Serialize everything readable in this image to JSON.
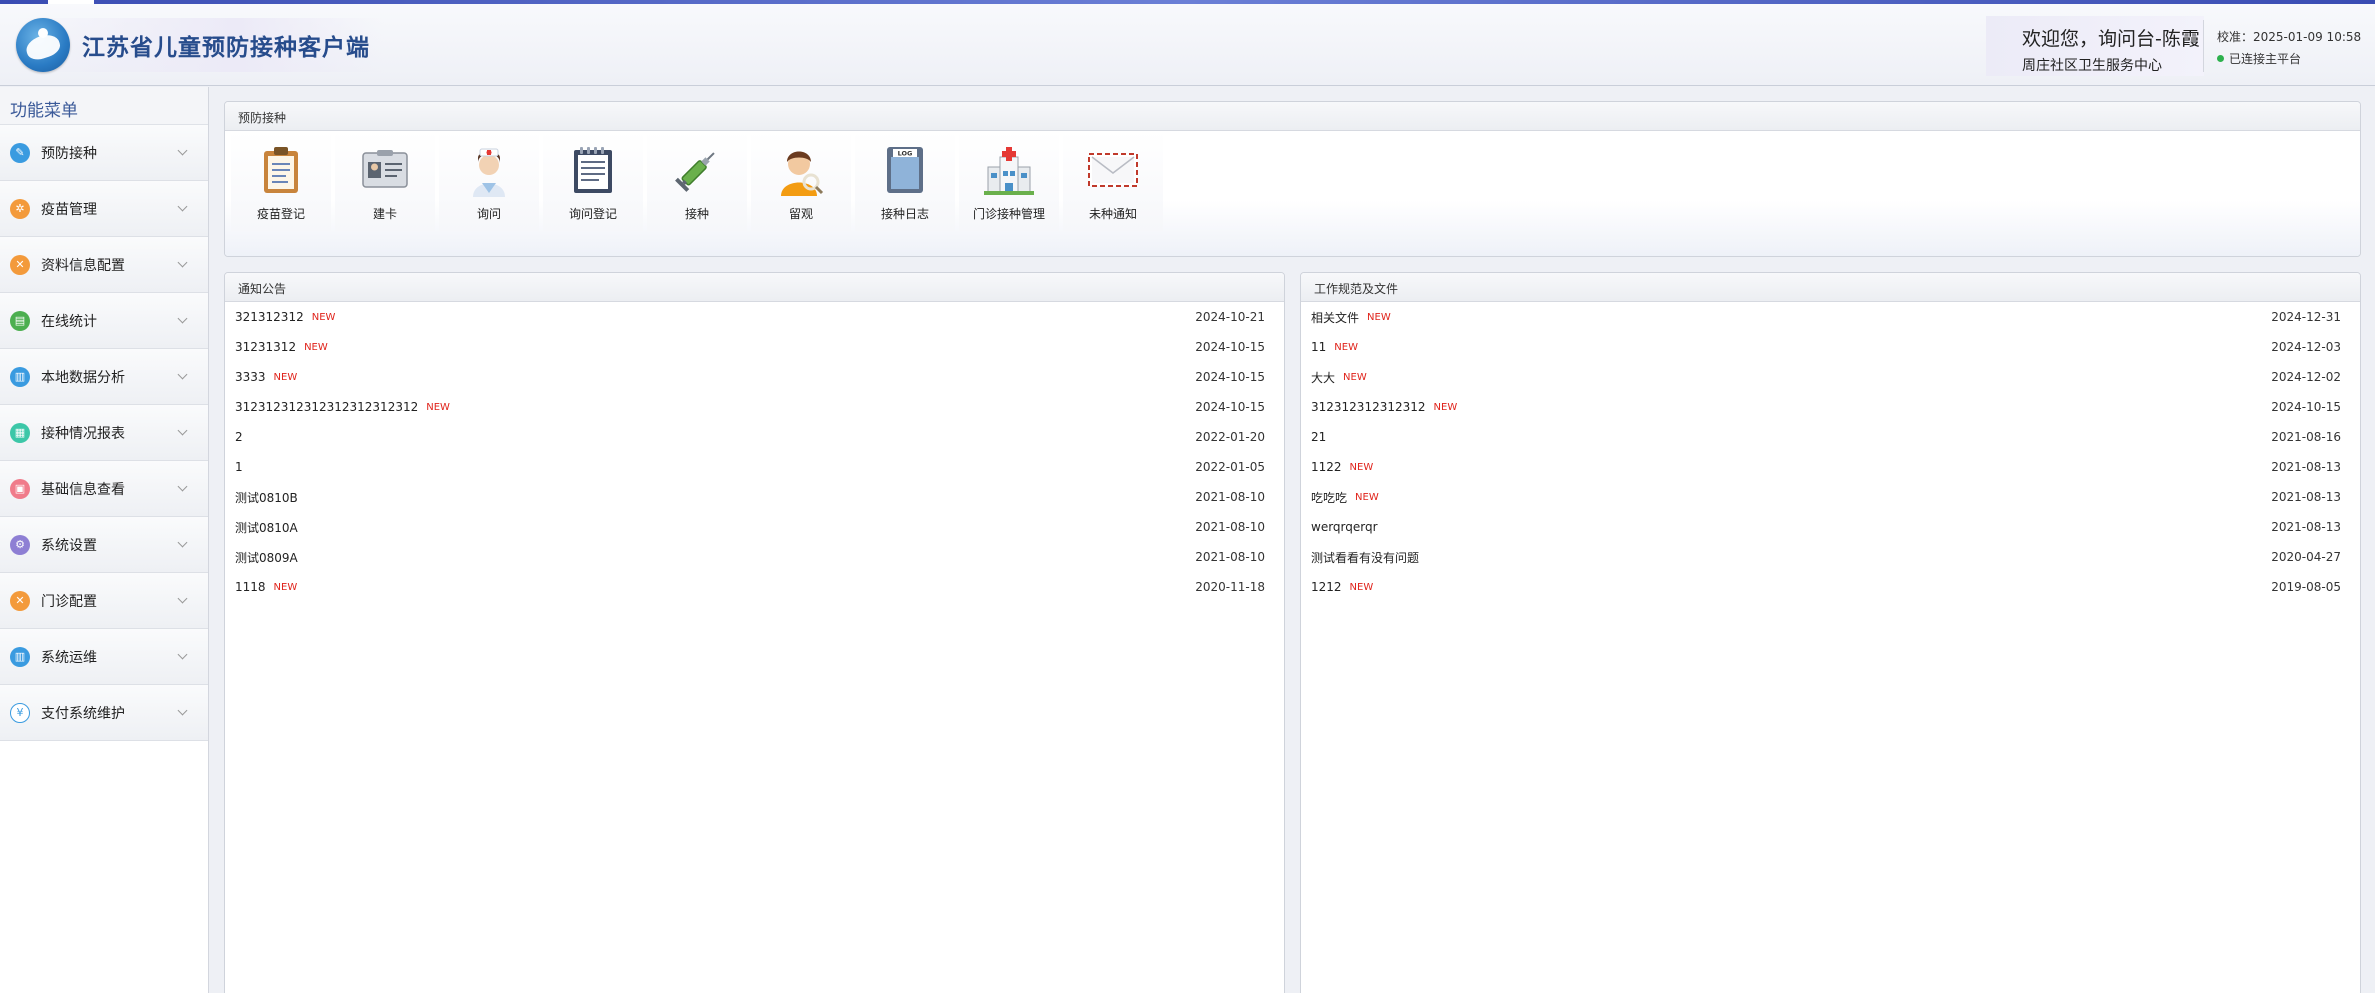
{
  "app": {
    "title": "江苏省儿童预防接种客户端",
    "welcome": "欢迎您，询问台-陈霞",
    "org": "周庄社区卫生服务中心",
    "sync_time": "校准：2025-01-09 10:58",
    "connection_status": "已连接主平台"
  },
  "sidebar": {
    "title": "功能菜单",
    "items": [
      {
        "label": "预防接种",
        "icon": "syringe-icon",
        "color": "#3a9be0",
        "glyph": "✎"
      },
      {
        "label": "疫苗管理",
        "icon": "vaccine-icon",
        "color": "#f39a3b",
        "glyph": "✲"
      },
      {
        "label": "资料信息配置",
        "icon": "config-icon",
        "color": "#f39a3b",
        "glyph": "✕"
      },
      {
        "label": "在线统计",
        "icon": "statistics-icon",
        "color": "#4caf50",
        "glyph": "▤"
      },
      {
        "label": "本地数据分析",
        "icon": "analysis-icon",
        "color": "#3a9be0",
        "glyph": "▥"
      },
      {
        "label": "接种情况报表",
        "icon": "report-icon",
        "color": "#3cc7a8",
        "glyph": "▦"
      },
      {
        "label": "基础信息查看",
        "icon": "info-icon",
        "color": "#f07b8a",
        "glyph": "▣"
      },
      {
        "label": "系统设置",
        "icon": "settings-icon",
        "color": "#8e7fd4",
        "glyph": "⚙"
      },
      {
        "label": "门诊配置",
        "icon": "clinic-config-icon",
        "color": "#f39a3b",
        "glyph": "✕"
      },
      {
        "label": "系统运维",
        "icon": "maintenance-icon",
        "color": "#3a9be0",
        "glyph": "▥"
      },
      {
        "label": "支付系统维护",
        "icon": "payment-icon",
        "color": "#ffffff",
        "glyph": "¥"
      }
    ]
  },
  "quick": {
    "title": "预防接种",
    "items": [
      {
        "label": "疫苗登记",
        "icon": "clipboard-icon"
      },
      {
        "label": "建卡",
        "icon": "id-card-icon"
      },
      {
        "label": "询问",
        "icon": "nurse-icon"
      },
      {
        "label": "询问登记",
        "icon": "notepad-icon"
      },
      {
        "label": "接种",
        "icon": "syringe-icon"
      },
      {
        "label": "留观",
        "icon": "observe-person-icon"
      },
      {
        "label": "接种日志",
        "icon": "log-icon"
      },
      {
        "label": "门诊接种管理",
        "icon": "hospital-icon"
      },
      {
        "label": "未种通知",
        "icon": "envelope-icon"
      }
    ]
  },
  "notices": {
    "title": "通知公告",
    "new_label": "NEW",
    "rows": [
      {
        "title": "321312312",
        "date": "2024-10-21",
        "new": true
      },
      {
        "title": "31231312",
        "date": "2024-10-15",
        "new": true
      },
      {
        "title": "3333",
        "date": "2024-10-15",
        "new": true
      },
      {
        "title": "312312312312312312312312",
        "date": "2024-10-15",
        "new": true
      },
      {
        "title": "2",
        "date": "2022-01-20",
        "new": false
      },
      {
        "title": "1",
        "date": "2022-01-05",
        "new": false
      },
      {
        "title": "测试0810B",
        "date": "2021-08-10",
        "new": false
      },
      {
        "title": "测试0810A",
        "date": "2021-08-10",
        "new": false
      },
      {
        "title": "测试0809A",
        "date": "2021-08-10",
        "new": false
      },
      {
        "title": "1118",
        "date": "2020-11-18",
        "new": true
      }
    ]
  },
  "documents": {
    "title": "工作规范及文件",
    "new_label": "NEW",
    "rows": [
      {
        "title": "相关文件",
        "date": "2024-12-31",
        "new": true
      },
      {
        "title": "11",
        "date": "2024-12-03",
        "new": true
      },
      {
        "title": "大大",
        "date": "2024-12-02",
        "new": true
      },
      {
        "title": "312312312312312",
        "date": "2024-10-15",
        "new": true
      },
      {
        "title": "21",
        "date": "2021-08-16",
        "new": false
      },
      {
        "title": "1122",
        "date": "2021-08-13",
        "new": true
      },
      {
        "title": "吃吃吃",
        "date": "2021-08-13",
        "new": true
      },
      {
        "title": "werqrqerqr",
        "date": "2021-08-13",
        "new": false
      },
      {
        "title": "测试看看有没有问题",
        "date": "2020-04-27",
        "new": false
      },
      {
        "title": "1212",
        "date": "2019-08-05",
        "new": true
      }
    ]
  }
}
